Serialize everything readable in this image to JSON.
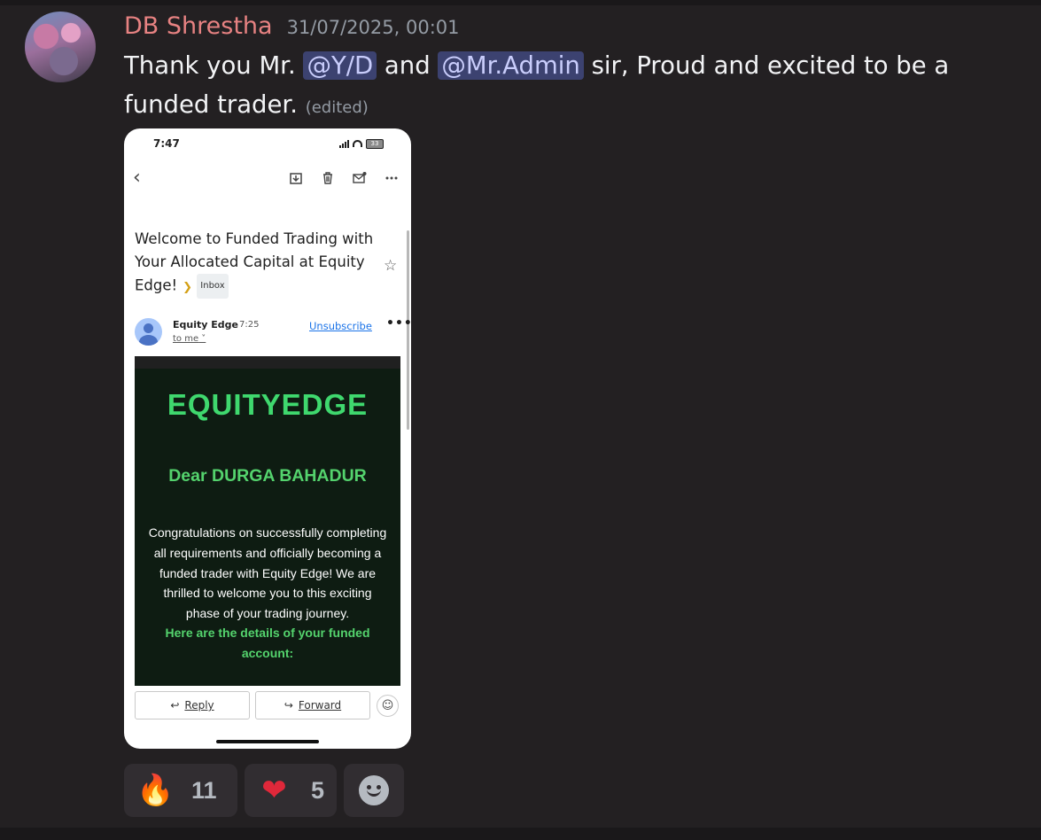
{
  "message": {
    "username": "DB Shrestha",
    "timestamp": "31/07/2025, 00:01",
    "text_part1": "Thank you Mr. ",
    "mention1": "@Y/D",
    "text_part2": " and ",
    "mention2": "@Mr.Admin",
    "text_part3": " sir, Proud and excited to be a funded trader.",
    "edited_label": "(edited)"
  },
  "phone": {
    "time": "7:47",
    "battery": "33",
    "email_subject": "Welcome to Funded Trading with Your Allocated Capital at Equity Edge!",
    "inbox_label": "Inbox",
    "sender_name": "Equity Edge",
    "sender_time": "7:25",
    "to_me": "to me",
    "unsubscribe": "Unsubscribe",
    "logo_text": "EQUITYEDGE",
    "greeting": "Dear DURGA BAHADUR",
    "congrats_text": "Congratulations on successfully completing all requirements and officially becoming a funded trader with Equity Edge! We are thrilled to welcome you to this exciting phase of your trading journey.",
    "details_text": "Here are the details of your funded account:",
    "reply_label": "Reply",
    "forward_label": "Forward"
  },
  "reactions": [
    {
      "emoji": "🔥",
      "count": "11"
    },
    {
      "emoji": "❤",
      "count": "5"
    },
    {
      "emoji": "add-reaction-icon",
      "count": ""
    }
  ],
  "colors": {
    "background": "#232022",
    "username": "#e78282",
    "mention_bg": "#3c4270",
    "email_bg": "#0e1c12",
    "email_accent": "#54d36d"
  }
}
